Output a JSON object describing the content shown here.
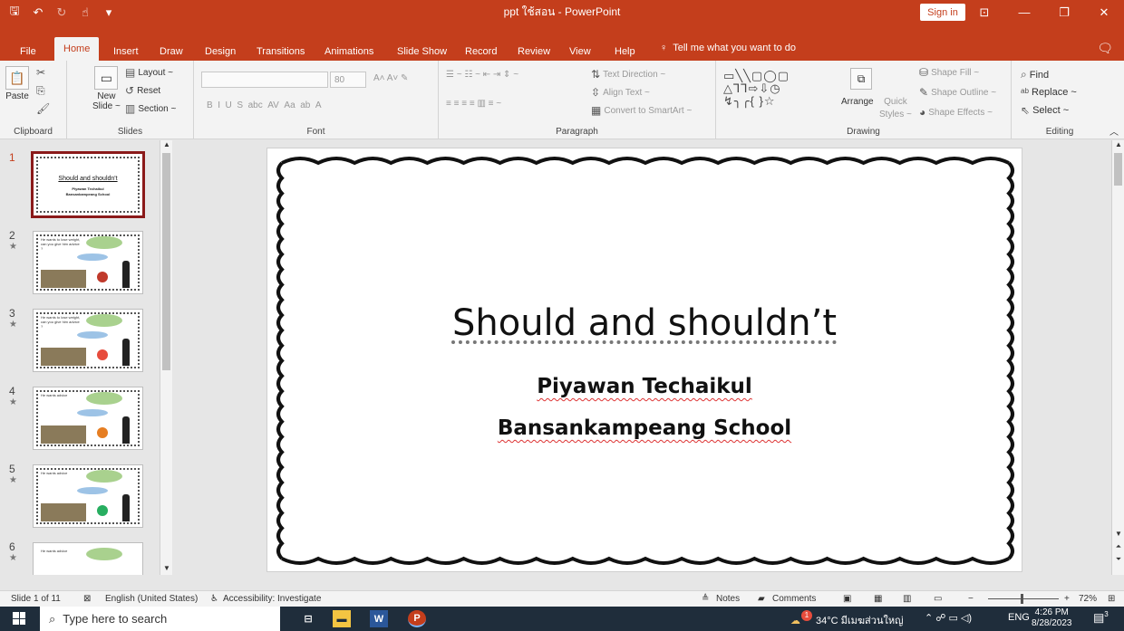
{
  "app": {
    "window_title": "ppt ใช้สอน - PowerPoint",
    "sign_in": "Sign in"
  },
  "tabs": [
    "File",
    "Home",
    "Insert",
    "Draw",
    "Design",
    "Transitions",
    "Animations",
    "Slide Show",
    "Record",
    "Review",
    "View",
    "Help"
  ],
  "tell_me": "Tell me what you want to do",
  "ribbon": {
    "clipboard": {
      "paste": "Paste",
      "label": "Clipboard"
    },
    "slides": {
      "new_slide_1": "New",
      "new_slide_2": "Slide ~",
      "layout": "Layout ~",
      "reset": "Reset",
      "section": "Section ~",
      "label": "Slides"
    },
    "font": {
      "size": "80",
      "label": "Font"
    },
    "paragraph": {
      "text_direction": "Text Direction ~",
      "align_text": "Align Text ~",
      "convert": "Convert to SmartArt ~",
      "label": "Paragraph"
    },
    "drawing": {
      "arrange": "Arrange",
      "quick_styles_1": "Quick",
      "quick_styles_2": "Styles ~",
      "shape_fill": "Shape Fill ~",
      "shape_outline": "Shape Outline ~",
      "shape_effects": "Shape Effects ~",
      "label": "Drawing"
    },
    "editing": {
      "find": "Find",
      "replace": "Replace ~",
      "select": "Select ~",
      "label": "Editing"
    }
  },
  "thumbnails": [
    {
      "number": "1",
      "title": "Should and shouldn't",
      "sub1": "Piyawan Techaikul",
      "sub2": "Bansankampeang School"
    },
    {
      "number": "2",
      "text": "He wants to lose weight, can you give him advice ?"
    },
    {
      "number": "3",
      "text": "He wants to lose weight, can you give him advice ?"
    },
    {
      "number": "4",
      "text": "He wants advice"
    },
    {
      "number": "5",
      "text": "He wants advice"
    },
    {
      "number": "6",
      "text": "He wants advice"
    }
  ],
  "slide": {
    "title": "Should and shouldn’t",
    "author": "Piyawan Techaikul",
    "school": "Bansankampeang School"
  },
  "status": {
    "slide_count": "Slide 1 of 11",
    "language": "English (United States)",
    "accessibility": "Accessibility: Investigate",
    "notes": "Notes",
    "comments": "Comments",
    "zoom": "72%"
  },
  "taskbar": {
    "search_placeholder": "Type here to search",
    "weather": "34°C มีเมฆส่วนใหญ่",
    "lang": "ENG",
    "time": "4:26 PM",
    "date": "8/28/2023",
    "notification_count": "3",
    "weather_badge": "1"
  }
}
